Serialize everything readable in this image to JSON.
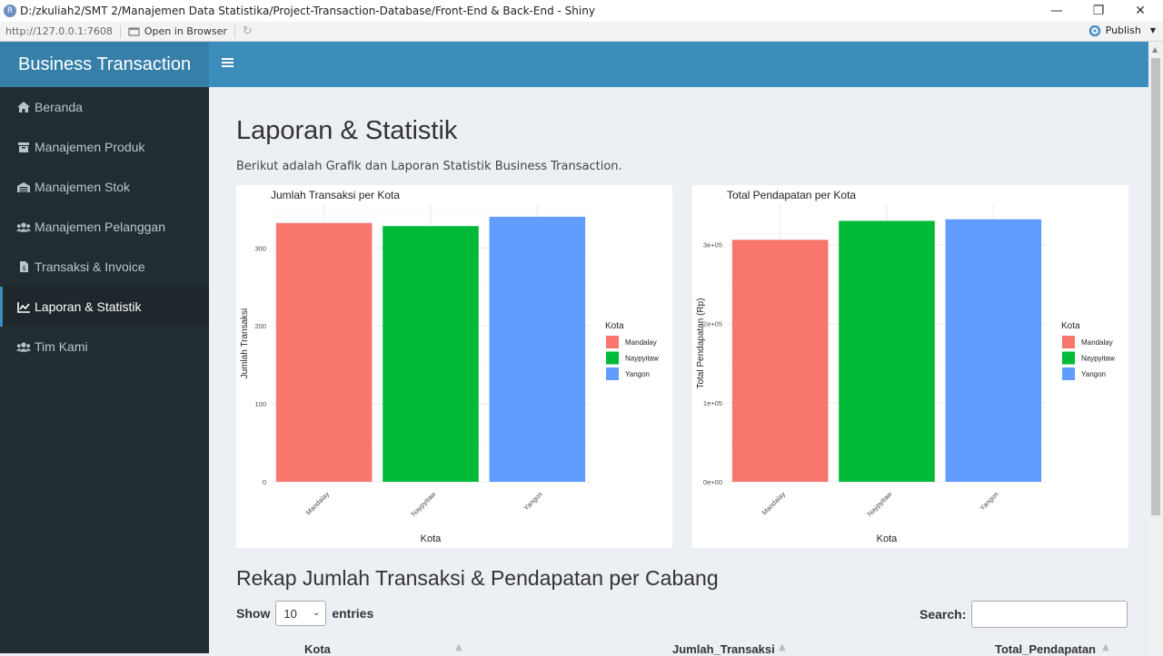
{
  "window": {
    "title": "D:/zkuliah2/SMT 2/Manajemen Data Statistika/Project-Transaction-Database/Front-End & Back-End - Shiny",
    "minimize": "—",
    "maximize": "❐",
    "close": "✕"
  },
  "toolbar": {
    "url": "http://127.0.0.1:7608",
    "open_in_browser": "Open in Browser",
    "publish": "Publish"
  },
  "header": {
    "brand": "Business Transaction",
    "toggle_icon": "hamburger-icon"
  },
  "sidebar": {
    "items": [
      {
        "label": "Beranda",
        "icon": "home-icon"
      },
      {
        "label": "Manajemen Produk",
        "icon": "box-icon"
      },
      {
        "label": "Manajemen Stok",
        "icon": "inventory-icon"
      },
      {
        "label": "Manajemen Pelanggan",
        "icon": "users-icon"
      },
      {
        "label": "Transaksi & Invoice",
        "icon": "invoice-icon"
      },
      {
        "label": "Laporan & Statistik",
        "icon": "line-chart-icon",
        "active": true
      },
      {
        "label": "Tim Kami",
        "icon": "team-icon"
      }
    ]
  },
  "main": {
    "title": "Laporan & Statistik",
    "subtitle": "Berikut adalah Grafik dan Laporan Statistik Business Transaction.",
    "section_title": "Rekap Jumlah Transaksi & Pendapatan per Cabang",
    "show_label": "Show",
    "entries_value": "10",
    "entries_label": "entries",
    "search_label": "Search:",
    "search_value": "",
    "table_columns": [
      "Kota",
      "Jumlah_Transaksi",
      "Total_Pendapatan"
    ]
  },
  "colors": {
    "Mandalay": "#F8766D",
    "Naypyitaw": "#00BA38",
    "Yangon": "#619CFF",
    "header": "#3c8dbc",
    "sidebar": "#222d32"
  },
  "chart_data": [
    {
      "type": "bar",
      "title": "Jumlah Transaksi per Kota",
      "xlabel": "Kota",
      "ylabel": "Jumlah Transaksi",
      "categories": [
        "Mandalay",
        "Naypyitaw",
        "Yangon"
      ],
      "values": [
        332,
        328,
        340
      ],
      "ylim": [
        0,
        355
      ],
      "yticks": [
        0,
        100,
        200,
        300
      ],
      "ytick_labels": [
        "0",
        "100",
        "200",
        "300"
      ],
      "legend_title": "Kota",
      "legend": [
        "Mandalay",
        "Naypyitaw",
        "Yangon"
      ],
      "legend_position": "right",
      "grid": true
    },
    {
      "type": "bar",
      "title": "Total Pendapatan per Kota",
      "xlabel": "Kota",
      "ylabel": "Total Pendapatan (Rp)",
      "categories": [
        "Mandalay",
        "Naypyitaw",
        "Yangon"
      ],
      "values": [
        306000,
        330000,
        332000
      ],
      "ylim": [
        0,
        350000
      ],
      "yticks": [
        0,
        100000,
        200000,
        300000
      ],
      "ytick_labels": [
        "0e+00",
        "1e+05",
        "2e+05",
        "3e+05"
      ],
      "legend_title": "Kota",
      "legend": [
        "Mandalay",
        "Naypyitaw",
        "Yangon"
      ],
      "legend_position": "right",
      "grid": true
    }
  ]
}
